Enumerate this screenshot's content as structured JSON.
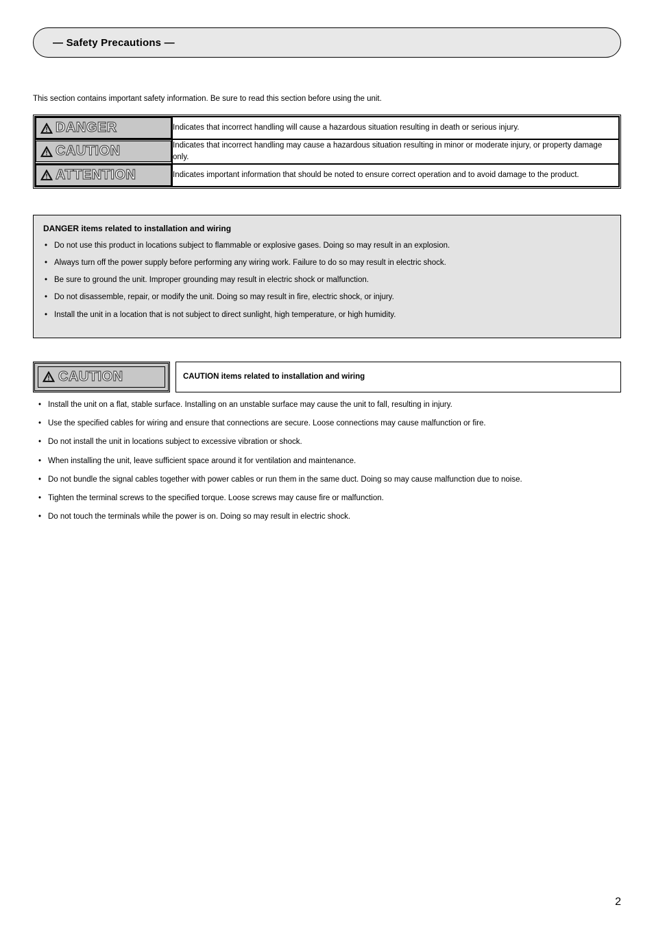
{
  "header": {
    "title": "— Safety Precautions —"
  },
  "intro": "This section contains important safety information. Be sure to read this section before using the unit.",
  "definitions": [
    {
      "label": "DANGER",
      "desc": "Indicates that incorrect handling will cause a hazardous situation resulting in death or serious injury."
    },
    {
      "label": "CAUTION",
      "desc": "Indicates that incorrect handling may cause a hazardous situation resulting in minor or moderate injury, or property damage only."
    },
    {
      "label": "ATTENTION",
      "desc": "Indicates important information that should be noted to ensure correct operation and to avoid damage to the product."
    }
  ],
  "dangerBox": {
    "title": "DANGER items related to installation and wiring",
    "items": [
      "Do not use this product in locations subject to flammable or explosive gases. Doing so may result in an explosion.",
      "Always turn off the power supply before performing any wiring work. Failure to do so may result in electric shock.",
      "Be sure to ground the unit. Improper grounding may result in electric shock or malfunction.",
      "Do not disassemble, repair, or modify the unit. Doing so may result in fire, electric shock, or injury.",
      "Install the unit in a location that is not subject to direct sunlight, high temperature, or high humidity."
    ]
  },
  "cautionSection": {
    "badge": "CAUTION",
    "title": "CAUTION items related to installation and wiring",
    "items": [
      "Install the unit on a flat, stable surface. Installing on an unstable surface may cause the unit to fall, resulting in injury.",
      "Use the specified cables for wiring and ensure that connections are secure. Loose connections may cause malfunction or fire.",
      "Do not install the unit in locations subject to excessive vibration or shock.",
      "When installing the unit, leave sufficient space around it for ventilation and maintenance.",
      "Do not bundle the signal cables together with power cables or run them in the same duct. Doing so may cause malfunction due to noise.",
      "Tighten the terminal screws to the specified torque. Loose screws may cause fire or malfunction.",
      "Do not touch the terminals while the power is on. Doing so may result in electric shock."
    ]
  },
  "pageNumber": "2"
}
